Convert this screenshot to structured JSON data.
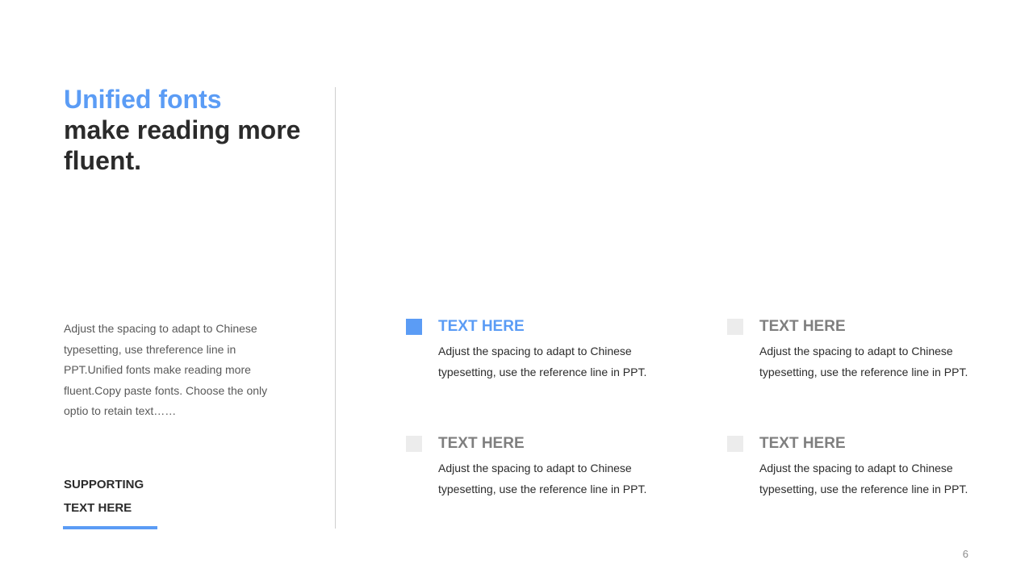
{
  "header": {
    "title_accent": "Unified fonts",
    "title_main": "make reading more fluent."
  },
  "intro": {
    "text": "Adjust the spacing to adapt to Chinese typesetting, use threference line in PPT.Unified fonts make reading more fluent.Copy paste fonts. Choose the only optio to retain text……"
  },
  "supporting": {
    "line1": "SUPPORTING",
    "line2": "TEXT HERE"
  },
  "features": [
    {
      "title": "TEXT HERE",
      "description": "Adjust the spacing to adapt to Chinese typesetting, use the reference line in PPT.",
      "active": true
    },
    {
      "title": "TEXT HERE",
      "description": "Adjust the spacing to adapt to Chinese typesetting, use the reference line in PPT.",
      "active": false
    },
    {
      "title": "TEXT HERE",
      "description": "Adjust the spacing to adapt to Chinese typesetting, use the reference line in PPT.",
      "active": false
    },
    {
      "title": "TEXT HERE",
      "description": "Adjust the spacing to adapt to Chinese typesetting, use the reference line in PPT.",
      "active": false
    }
  ],
  "page_number": "6",
  "colors": {
    "accent": "#5b9cf5",
    "heading": "#2b2b2b",
    "muted_marker": "#ececec",
    "muted_title": "#7f7f7f"
  }
}
